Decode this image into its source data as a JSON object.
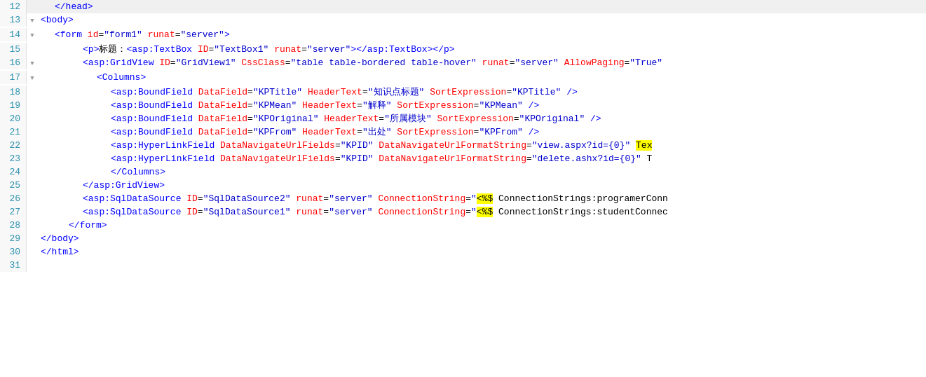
{
  "editor": {
    "lines": [
      {
        "num": 12,
        "collapse": "none",
        "content": [
          {
            "type": "indent",
            "size": 1
          },
          {
            "type": "angle",
            "text": "</"
          },
          {
            "type": "tag",
            "text": "head"
          },
          {
            "type": "angle",
            "text": ">"
          }
        ]
      },
      {
        "num": 13,
        "collapse": "collapse",
        "content": [
          {
            "type": "angle",
            "text": "<"
          },
          {
            "type": "tag",
            "text": "body"
          },
          {
            "type": "angle",
            "text": ">"
          }
        ]
      },
      {
        "num": 14,
        "collapse": "collapse",
        "content": [
          {
            "type": "indent",
            "size": 1
          },
          {
            "type": "angle",
            "text": "<"
          },
          {
            "type": "tag",
            "text": "form"
          },
          {
            "type": "text",
            "text": " "
          },
          {
            "type": "attr",
            "text": "id"
          },
          {
            "type": "text",
            "text": "="
          },
          {
            "type": "attrval",
            "text": "\"form1\""
          },
          {
            "type": "text",
            "text": " "
          },
          {
            "type": "attr",
            "text": "runat"
          },
          {
            "type": "text",
            "text": "="
          },
          {
            "type": "attrval",
            "text": "\"server\""
          },
          {
            "type": "angle",
            "text": ">"
          }
        ]
      },
      {
        "num": 15,
        "collapse": "none",
        "content": [
          {
            "type": "indent",
            "size": 3
          },
          {
            "type": "angle",
            "text": "<"
          },
          {
            "type": "tag",
            "text": "p"
          },
          {
            "type": "angle",
            "text": ">"
          },
          {
            "type": "text",
            "text": "标题："
          },
          {
            "type": "angle",
            "text": "<"
          },
          {
            "type": "tag",
            "text": "asp:TextBox"
          },
          {
            "type": "text",
            "text": " "
          },
          {
            "type": "attr",
            "text": "ID"
          },
          {
            "type": "text",
            "text": "="
          },
          {
            "type": "attrval",
            "text": "\"TextBox1\""
          },
          {
            "type": "text",
            "text": " "
          },
          {
            "type": "attr",
            "text": "runat"
          },
          {
            "type": "text",
            "text": "="
          },
          {
            "type": "attrval",
            "text": "\"server\""
          },
          {
            "type": "angle",
            "text": "></"
          },
          {
            "type": "tag",
            "text": "asp:TextBox"
          },
          {
            "type": "angle",
            "text": "></"
          },
          {
            "type": "tag",
            "text": "p"
          },
          {
            "type": "angle",
            "text": ">"
          }
        ]
      },
      {
        "num": 16,
        "collapse": "collapse",
        "content": [
          {
            "type": "indent",
            "size": 3
          },
          {
            "type": "angle",
            "text": "<"
          },
          {
            "type": "tag",
            "text": "asp:GridView"
          },
          {
            "type": "text",
            "text": " "
          },
          {
            "type": "attr",
            "text": "ID"
          },
          {
            "type": "text",
            "text": "="
          },
          {
            "type": "attrval",
            "text": "\"GridView1\""
          },
          {
            "type": "text",
            "text": " "
          },
          {
            "type": "attr",
            "text": "CssClass"
          },
          {
            "type": "text",
            "text": "="
          },
          {
            "type": "attrval",
            "text": "\"table table-bordered table-hover\""
          },
          {
            "type": "text",
            "text": " "
          },
          {
            "type": "attr",
            "text": "runat"
          },
          {
            "type": "text",
            "text": "="
          },
          {
            "type": "attrval",
            "text": "\"server\""
          },
          {
            "type": "text",
            "text": " "
          },
          {
            "type": "attr",
            "text": "AllowPaging"
          },
          {
            "type": "text",
            "text": "="
          },
          {
            "type": "attrval",
            "text": "\"True\""
          }
        ]
      },
      {
        "num": 17,
        "collapse": "collapse",
        "content": [
          {
            "type": "indent",
            "size": 4
          },
          {
            "type": "angle",
            "text": "<"
          },
          {
            "type": "tag",
            "text": "Columns"
          },
          {
            "type": "angle",
            "text": ">"
          }
        ]
      },
      {
        "num": 18,
        "collapse": "none",
        "content": [
          {
            "type": "indent",
            "size": 5
          },
          {
            "type": "angle",
            "text": "<"
          },
          {
            "type": "tag",
            "text": "asp:BoundField"
          },
          {
            "type": "text",
            "text": " "
          },
          {
            "type": "attr",
            "text": "DataField"
          },
          {
            "type": "text",
            "text": "="
          },
          {
            "type": "attrval",
            "text": "\"KPTitle\""
          },
          {
            "type": "text",
            "text": " "
          },
          {
            "type": "attr",
            "text": "HeaderText"
          },
          {
            "type": "text",
            "text": "="
          },
          {
            "type": "attrval",
            "text": "\"知识点标题\""
          },
          {
            "type": "text",
            "text": " "
          },
          {
            "type": "attr",
            "text": "SortExpression"
          },
          {
            "type": "text",
            "text": "="
          },
          {
            "type": "attrval",
            "text": "\"KPTitle\""
          },
          {
            "type": "text",
            "text": " "
          },
          {
            "type": "angle",
            "text": "/>"
          }
        ]
      },
      {
        "num": 19,
        "collapse": "none",
        "content": [
          {
            "type": "indent",
            "size": 5
          },
          {
            "type": "angle",
            "text": "<"
          },
          {
            "type": "tag",
            "text": "asp:BoundField"
          },
          {
            "type": "text",
            "text": " "
          },
          {
            "type": "attr",
            "text": "DataField"
          },
          {
            "type": "text",
            "text": "="
          },
          {
            "type": "attrval",
            "text": "\"KPMean\""
          },
          {
            "type": "text",
            "text": " "
          },
          {
            "type": "attr",
            "text": "HeaderText"
          },
          {
            "type": "text",
            "text": "="
          },
          {
            "type": "attrval",
            "text": "\"解释\""
          },
          {
            "type": "text",
            "text": " "
          },
          {
            "type": "attr",
            "text": "SortExpression"
          },
          {
            "type": "text",
            "text": "="
          },
          {
            "type": "attrval",
            "text": "\"KPMean\""
          },
          {
            "type": "text",
            "text": " "
          },
          {
            "type": "angle",
            "text": "/>"
          }
        ]
      },
      {
        "num": 20,
        "collapse": "none",
        "content": [
          {
            "type": "indent",
            "size": 5
          },
          {
            "type": "angle",
            "text": "<"
          },
          {
            "type": "tag",
            "text": "asp:BoundField"
          },
          {
            "type": "text",
            "text": " "
          },
          {
            "type": "attr",
            "text": "DataField"
          },
          {
            "type": "text",
            "text": "="
          },
          {
            "type": "attrval",
            "text": "\"KPOriginal\""
          },
          {
            "type": "text",
            "text": " "
          },
          {
            "type": "attr",
            "text": "HeaderText"
          },
          {
            "type": "text",
            "text": "="
          },
          {
            "type": "attrval",
            "text": "\"所属模块\""
          },
          {
            "type": "text",
            "text": " "
          },
          {
            "type": "attr",
            "text": "SortExpression"
          },
          {
            "type": "text",
            "text": "="
          },
          {
            "type": "attrval",
            "text": "\"KPOriginal\""
          },
          {
            "type": "text",
            "text": " "
          },
          {
            "type": "angle",
            "text": "/>"
          }
        ]
      },
      {
        "num": 21,
        "collapse": "none",
        "content": [
          {
            "type": "indent",
            "size": 5
          },
          {
            "type": "angle",
            "text": "<"
          },
          {
            "type": "tag",
            "text": "asp:BoundField"
          },
          {
            "type": "text",
            "text": " "
          },
          {
            "type": "attr",
            "text": "DataField"
          },
          {
            "type": "text",
            "text": "="
          },
          {
            "type": "attrval",
            "text": "\"KPFrom\""
          },
          {
            "type": "text",
            "text": " "
          },
          {
            "type": "attr",
            "text": "HeaderText"
          },
          {
            "type": "text",
            "text": "="
          },
          {
            "type": "attrval",
            "text": "\"出处\""
          },
          {
            "type": "text",
            "text": " "
          },
          {
            "type": "attr",
            "text": "SortExpression"
          },
          {
            "type": "text",
            "text": "="
          },
          {
            "type": "attrval",
            "text": "\"KPFrom\""
          },
          {
            "type": "text",
            "text": " "
          },
          {
            "type": "angle",
            "text": "/>"
          }
        ]
      },
      {
        "num": 22,
        "collapse": "none",
        "content": [
          {
            "type": "indent",
            "size": 5
          },
          {
            "type": "angle",
            "text": "<"
          },
          {
            "type": "tag",
            "text": "asp:HyperLinkField"
          },
          {
            "type": "text",
            "text": " "
          },
          {
            "type": "attr",
            "text": "DataNavigateUrlFields"
          },
          {
            "type": "text",
            "text": "="
          },
          {
            "type": "attrval",
            "text": "\"KPID\""
          },
          {
            "type": "text",
            "text": " "
          },
          {
            "type": "attr",
            "text": "DataNavigateUrlFormatString"
          },
          {
            "type": "text",
            "text": "="
          },
          {
            "type": "attrval",
            "text": "\"view.aspx?id={0}\""
          },
          {
            "type": "text",
            "text": " "
          },
          {
            "type": "highlighted",
            "text": "Tex"
          }
        ]
      },
      {
        "num": 23,
        "collapse": "none",
        "content": [
          {
            "type": "indent",
            "size": 5
          },
          {
            "type": "angle",
            "text": "<"
          },
          {
            "type": "tag",
            "text": "asp:HyperLinkField"
          },
          {
            "type": "text",
            "text": " "
          },
          {
            "type": "attr",
            "text": "DataNavigateUrlFields"
          },
          {
            "type": "text",
            "text": "="
          },
          {
            "type": "attrval",
            "text": "\"KPID\""
          },
          {
            "type": "text",
            "text": " "
          },
          {
            "type": "attr",
            "text": "DataNavigateUrlFormatString"
          },
          {
            "type": "text",
            "text": "="
          },
          {
            "type": "attrval",
            "text": "\"delete.ashx?id={0}\""
          },
          {
            "type": "text",
            "text": " T"
          }
        ]
      },
      {
        "num": 24,
        "collapse": "none",
        "content": [
          {
            "type": "indent",
            "size": 5
          },
          {
            "type": "angle",
            "text": "</"
          },
          {
            "type": "tag",
            "text": "Columns"
          },
          {
            "type": "angle",
            "text": ">"
          }
        ]
      },
      {
        "num": 25,
        "collapse": "none",
        "content": [
          {
            "type": "indent",
            "size": 3
          },
          {
            "type": "angle",
            "text": "</"
          },
          {
            "type": "tag",
            "text": "asp:GridView"
          },
          {
            "type": "angle",
            "text": ">"
          }
        ]
      },
      {
        "num": 26,
        "collapse": "none",
        "content": [
          {
            "type": "indent",
            "size": 3
          },
          {
            "type": "angle",
            "text": "<"
          },
          {
            "type": "tag",
            "text": "asp:SqlDataSource"
          },
          {
            "type": "text",
            "text": " "
          },
          {
            "type": "attr",
            "text": "ID"
          },
          {
            "type": "text",
            "text": "="
          },
          {
            "type": "attrval",
            "text": "\"SqlDataSource2\""
          },
          {
            "type": "text",
            "text": " "
          },
          {
            "type": "attr",
            "text": "runat"
          },
          {
            "type": "text",
            "text": "="
          },
          {
            "type": "attrval",
            "text": "\"server\""
          },
          {
            "type": "text",
            "text": " "
          },
          {
            "type": "attr",
            "text": "ConnectionString"
          },
          {
            "type": "text",
            "text": "="
          },
          {
            "type": "attrval",
            "text": "\""
          },
          {
            "type": "highlight-tag",
            "text": "<%$"
          },
          {
            "type": "text",
            "text": " ConnectionStrings:programerConn"
          }
        ]
      },
      {
        "num": 27,
        "collapse": "none",
        "content": [
          {
            "type": "indent",
            "size": 3
          },
          {
            "type": "angle",
            "text": "<"
          },
          {
            "type": "tag",
            "text": "asp:SqlDataSource"
          },
          {
            "type": "text",
            "text": " "
          },
          {
            "type": "attr",
            "text": "ID"
          },
          {
            "type": "text",
            "text": "="
          },
          {
            "type": "attrval",
            "text": "\"SqlDataSource1\""
          },
          {
            "type": "text",
            "text": " "
          },
          {
            "type": "attr",
            "text": "runat"
          },
          {
            "type": "text",
            "text": "="
          },
          {
            "type": "attrval",
            "text": "\"server\""
          },
          {
            "type": "text",
            "text": " "
          },
          {
            "type": "attr",
            "text": "ConnectionString"
          },
          {
            "type": "text",
            "text": "="
          },
          {
            "type": "attrval",
            "text": "\""
          },
          {
            "type": "highlight-tag",
            "text": "<%$"
          },
          {
            "type": "text",
            "text": " ConnectionStrings:studentConnec"
          }
        ]
      },
      {
        "num": 28,
        "collapse": "none",
        "content": [
          {
            "type": "indent",
            "size": 2
          },
          {
            "type": "angle",
            "text": "</"
          },
          {
            "type": "tag",
            "text": "form"
          },
          {
            "type": "angle",
            "text": ">"
          }
        ]
      },
      {
        "num": 29,
        "collapse": "none",
        "content": [
          {
            "type": "angle",
            "text": "</"
          },
          {
            "type": "tag",
            "text": "body"
          },
          {
            "type": "angle",
            "text": ">"
          }
        ]
      },
      {
        "num": 30,
        "collapse": "none",
        "content": [
          {
            "type": "angle",
            "text": "</"
          },
          {
            "type": "tag",
            "text": "html"
          },
          {
            "type": "angle",
            "text": ">"
          }
        ]
      },
      {
        "num": 31,
        "collapse": "none",
        "content": []
      }
    ]
  }
}
